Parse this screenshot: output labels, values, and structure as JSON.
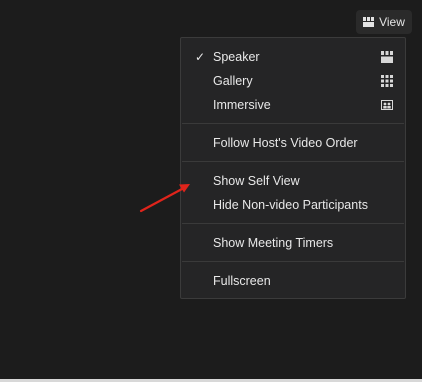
{
  "header": {
    "view_button_label": "View",
    "view_button_icon": "grid-icon"
  },
  "menu": {
    "check_glyph": "✓",
    "items": [
      {
        "label": "Speaker",
        "checked": true,
        "icon": "speaker-view-icon"
      },
      {
        "label": "Gallery",
        "checked": false,
        "icon": "gallery-view-icon"
      },
      {
        "label": "Immersive",
        "checked": false,
        "icon": "immersive-view-icon"
      },
      {
        "label": "Follow Host's Video Order",
        "checked": false
      },
      {
        "label": "Show Self View",
        "checked": false
      },
      {
        "label": "Hide Non-video Participants",
        "checked": false
      },
      {
        "label": "Show Meeting Timers",
        "checked": false
      },
      {
        "label": "Fullscreen",
        "checked": false
      }
    ]
  },
  "annotation": {
    "arrow_color": "#e0241b",
    "arrow_target": "Show Self View"
  },
  "colors": {
    "background": "#1c1c1c",
    "menu_background": "#252526",
    "menu_border": "#3b3b3b",
    "text": "#e8e8e8"
  }
}
